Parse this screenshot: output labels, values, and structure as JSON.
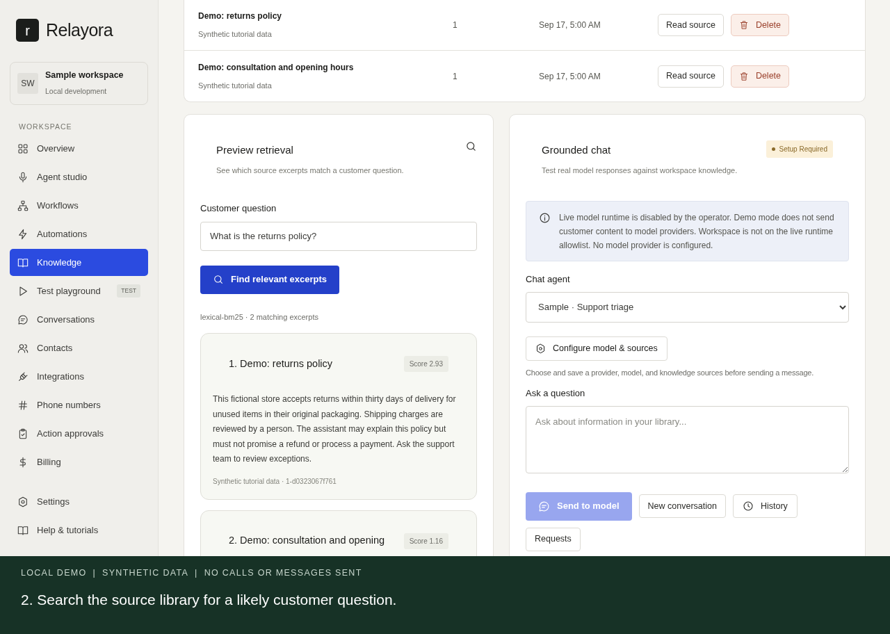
{
  "brand": {
    "logo_letter": "r",
    "name": "Relayora"
  },
  "workspace": {
    "initials": "SW",
    "name": "Sample workspace",
    "subtitle": "Local development"
  },
  "sidebar": {
    "section_label": "WORKSPACE",
    "items": [
      {
        "label": "Overview",
        "selected": false
      },
      {
        "label": "Agent studio",
        "selected": false
      },
      {
        "label": "Workflows",
        "selected": false
      },
      {
        "label": "Automations",
        "selected": false
      },
      {
        "label": "Knowledge",
        "selected": true
      },
      {
        "label": "Test playground",
        "selected": false,
        "badge": "TEST"
      },
      {
        "label": "Conversations",
        "selected": false
      },
      {
        "label": "Contacts",
        "selected": false
      },
      {
        "label": "Integrations",
        "selected": false
      },
      {
        "label": "Phone numbers",
        "selected": false
      },
      {
        "label": "Action approvals",
        "selected": false
      },
      {
        "label": "Billing",
        "selected": false
      }
    ],
    "footer_items": [
      {
        "label": "Settings",
        "selected": false
      },
      {
        "label": "Help & tutorials",
        "selected": false
      }
    ]
  },
  "sources_table": {
    "rows": [
      {
        "title": "Demo: returns policy",
        "subtitle": "Synthetic tutorial data",
        "count": "1",
        "date": "Sep 17, 5:00 AM",
        "read_button": "Read source",
        "delete_button": "Delete"
      },
      {
        "title": "Demo: consultation and opening hours",
        "subtitle": "Synthetic tutorial data",
        "count": "1",
        "date": "Sep 17, 5:00 AM",
        "read_button": "Read source",
        "delete_button": "Delete"
      }
    ]
  },
  "preview_retrieval": {
    "title": "Preview retrieval",
    "subtitle": "See which source excerpts match a customer question.",
    "question_label": "Customer question",
    "question_value": "What is the returns policy?",
    "find_button": "Find relevant excerpts",
    "result_summary": "lexical-bm25 · 2 matching excerpts",
    "results": [
      {
        "title": "1. Demo: returns policy",
        "score": "Score 2.93",
        "body": "This fictional store accepts returns within thirty days of delivery for unused items in their original packaging. Shipping charges are reviewed by a person. The assistant may explain this policy but must not promise a refund or process a payment. Ask the support team to review exceptions.",
        "meta": "Synthetic tutorial data · 1-d0323067f761"
      },
      {
        "title": "2. Demo: consultation and opening",
        "score": "Score 1.16"
      }
    ]
  },
  "grounded_chat": {
    "title": "Grounded chat",
    "subtitle": "Test real model responses against workspace knowledge.",
    "status_badge": "Setup Required",
    "notice": "Live model runtime is disabled by the operator. Demo mode does not send customer content to model providers. Workspace is not on the live runtime allowlist. No model provider is configured.",
    "agent_label": "Chat agent",
    "agent_value": "Sample · Support triage",
    "configure_button": "Configure model & sources",
    "configure_hint": "Choose and save a provider, model, and knowledge sources before sending a message.",
    "question_label": "Ask a question",
    "question_placeholder": "Ask about information in your library...",
    "buttons": [
      {
        "kind": "send",
        "label": "Send to model",
        "disabled": true
      },
      {
        "kind": "plain",
        "label": "New conversation",
        "disabled": false
      },
      {
        "kind": "history",
        "label": "History",
        "disabled": false
      },
      {
        "kind": "plain",
        "label": "Requests",
        "disabled": false
      }
    ]
  },
  "caption_bar": {
    "tags": [
      "LOCAL DEMO",
      "SYNTHETIC DATA",
      "NO CALLS OR MESSAGES SENT"
    ],
    "separator": "|",
    "text": "2. Search the source library for a likely customer question."
  }
}
